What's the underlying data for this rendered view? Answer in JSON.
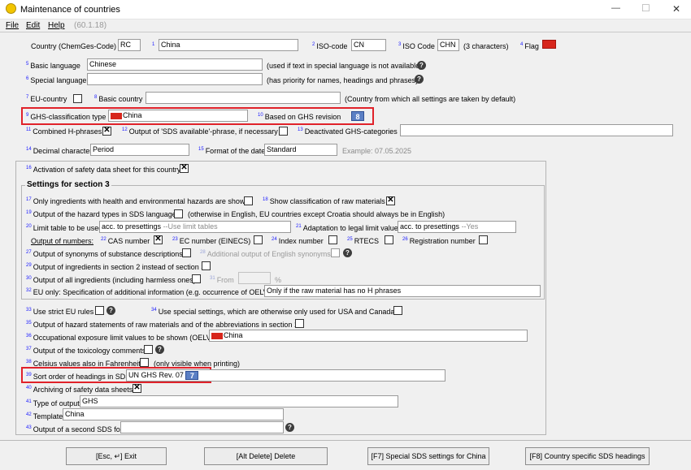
{
  "window": {
    "title": "Maintenance of countries",
    "min": "—",
    "max": "☐",
    "close": "✕"
  },
  "menu": {
    "file": "File",
    "edit": "Edit",
    "help": "Help",
    "version": "(60.1.18)"
  },
  "row1": {
    "country_label": "Country (ChemGes-Code)",
    "country_code": "RC",
    "n1": "1",
    "country_name": "China",
    "n2": "2",
    "iso_label": "ISO-code",
    "iso_value": "CN",
    "n3": "3",
    "iso3_label": "ISO Code",
    "iso3_value": "CHN",
    "iso3_hint": "(3 characters)",
    "n4": "4",
    "flag_label": "Flag"
  },
  "lang": {
    "n5": "5",
    "basic_label": "Basic language",
    "basic_value": "Chinese",
    "basic_hint": "(used if text in special language is not available)",
    "n6": "6",
    "special_label": "Special language",
    "special_value": "",
    "special_hint": "(has priority for names, headings and phrases)"
  },
  "eu": {
    "n7": "7",
    "eu_label": "EU-country",
    "n8": "8",
    "basic_country_label": "Basic country",
    "basic_country_value": "",
    "basic_country_hint": "(Country from which all settings are taken by default)"
  },
  "ghs": {
    "n9": "9",
    "type_label": "GHS-classification type",
    "type_value": "China",
    "n10": "10",
    "revision_label": "Based on GHS revision",
    "revision_value": "8"
  },
  "row11": {
    "n11": "11",
    "combined_label": "Combined H-phrases",
    "n12": "12",
    "sds_available_label": "Output of 'SDS available'-phrase, if necessary",
    "n13": "13",
    "deactivated_label": "Deactivated GHS-categories",
    "deactivated_value": ""
  },
  "row14": {
    "n14": "14",
    "decimal_label": "Decimal character",
    "decimal_value": "Period",
    "n15": "15",
    "date_label": "Format of the date",
    "date_value": "Standard",
    "date_example": "Example: 07.05.2025"
  },
  "sds": {
    "n16": "16",
    "activation_label": "Activation of safety data sheet for this country"
  },
  "sec3": {
    "title": "Settings for section 3",
    "n17": "17",
    "only_ingredients": "Only ingredients with health and environmental hazards are shown",
    "n18": "18",
    "show_classification": "Show classification of raw materials",
    "n19": "19",
    "output_hazard_types": "Output of the hazard types in SDS language",
    "hazard_hint": "(otherwise in English, EU countries except Croatia should always be in English)",
    "n20": "20",
    "limit_table_label": "Limit table to be used",
    "limit_table_value": "acc. to presettings",
    "limit_table_gray": "--Use limit tables",
    "n21": "21",
    "adaptation_label": "Adaptation to legal limit values",
    "adaptation_value": "acc. to presettings",
    "adaptation_gray": "--Yes",
    "output_numbers": "Output of numbers:",
    "n22": "22",
    "cas": "CAS number",
    "n23": "23",
    "ec": "EC number (EINECS)",
    "n24": "24",
    "index": "Index number",
    "n25": "25",
    "rtecs": "RTECS",
    "n26": "26",
    "registration": "Registration number",
    "n27": "27",
    "synonyms": "Output of synonyms of substance descriptions",
    "n28": "28",
    "english_synonyms": "Additional output of English synonyms",
    "n29": "29",
    "section2": "Output of ingredients in section 2 instead of section 3",
    "n30": "30",
    "all_ingredients": "Output of all ingredients (including harmless ones)",
    "n31": "31",
    "from_label": "From",
    "from_value": "",
    "percent": "%",
    "n32": "32",
    "eu_only_label": "EU only: Specification of additional information (e.g. occurrence of OELVs)",
    "eu_only_value": "Only if the raw material has no H phrases"
  },
  "lower": {
    "n33": "33",
    "strict_eu": "Use strict EU rules",
    "n34": "34",
    "special_usa": "Use special settings, which are otherwise only used for USA and Canada",
    "n35": "35",
    "hazard_statements": "Output of hazard statements of raw materials and of the abbreviations in section 16",
    "n36": "36",
    "oelv_label": "Occupational exposure limit values to be shown (OELV)",
    "oelv_value": "China",
    "n37": "37",
    "toxicology": "Output of the toxicology comments",
    "n38": "38",
    "celsius": "Celsius values also in Fahrenheit",
    "celsius_hint": "(only visible when printing)",
    "n39": "39",
    "sort_label": "Sort order of headings in SDS",
    "sort_value": "UN GHS Rev. 07",
    "sort_badge": "7",
    "n40": "40",
    "archiving": "Archiving of safety data sheets",
    "n41": "41",
    "type_output_label": "Type of output",
    "type_output_value": "GHS",
    "n42": "42",
    "template_label": "Template",
    "template_value": "China",
    "n43": "43",
    "second_sds_label": "Output of a second SDS for",
    "second_sds_value": ""
  },
  "buttons": {
    "exit": "[Esc, ↵] Exit",
    "delete": "[Alt Delete] Delete",
    "special": "[F7] Special SDS settings for China",
    "headings": "[F8] Country specific SDS headings"
  },
  "colors": {
    "highlight": "#e0222a",
    "flag_red": "#d7261c",
    "badge_blue": "#5b7fc4"
  }
}
